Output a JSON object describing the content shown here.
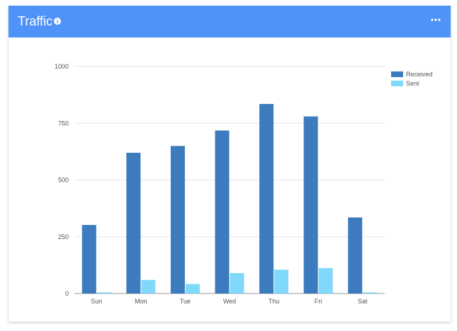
{
  "header": {
    "title": "Traffic",
    "info_icon": "info-icon",
    "menu_icon": "more-horizontal-icon",
    "background": "#4f93f8"
  },
  "chart_data": {
    "type": "bar",
    "categories": [
      "Sun",
      "Mon",
      "Tue",
      "Wed",
      "Thu",
      "Fri",
      "Sat"
    ],
    "series": [
      {
        "name": "Received",
        "color": "#3d7bbf",
        "values": [
          302,
          620,
          650,
          718,
          835,
          780,
          335
        ]
      },
      {
        "name": "Sent",
        "color": "#80d8fb",
        "values": [
          5,
          60,
          42,
          90,
          105,
          112,
          5
        ]
      }
    ],
    "yticks": [
      0,
      250,
      500,
      750,
      1000
    ],
    "ylim": [
      0,
      1000
    ],
    "grid": true,
    "legend": "right"
  }
}
